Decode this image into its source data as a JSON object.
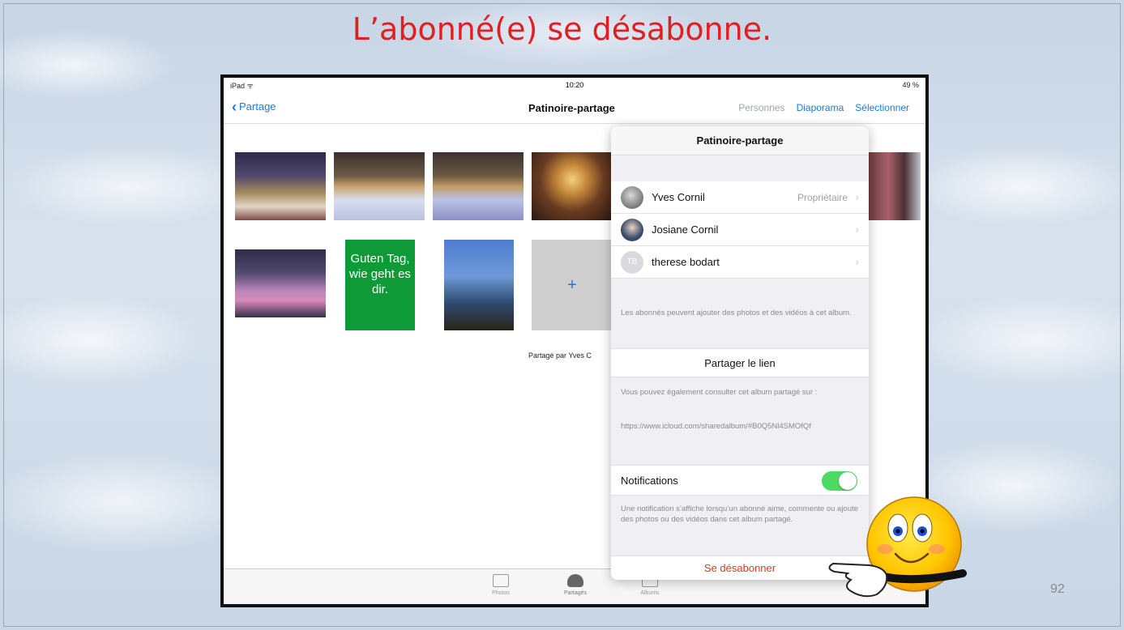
{
  "slide": {
    "title": "L’abonné(e) se désabonne.",
    "page_number": "92"
  },
  "ipad": {
    "status": {
      "left": "iPad ᯤ",
      "time": "10:20",
      "battery": "49 %"
    },
    "nav": {
      "back_label": "Partage",
      "title": "Patinoire-partage",
      "people": "Personnes",
      "slideshow": "Diaporama",
      "select": "Sélectionner"
    },
    "text_card": "Guten Tag, wie geht es dir.",
    "add_tile": "+",
    "shared_by": "Partagé par Yves C",
    "tabs": [
      {
        "label": "Photos",
        "icon": "photos-icon"
      },
      {
        "label": "Partagés",
        "icon": "cloud-icon"
      },
      {
        "label": "Albums",
        "icon": "albums-icon"
      }
    ]
  },
  "popover": {
    "title": "Patinoire-partage",
    "people": [
      {
        "name": "Yves Cornil",
        "role": "Propriétaire",
        "initials": ""
      },
      {
        "name": "Josiane Cornil",
        "role": "",
        "initials": ""
      },
      {
        "name": "therese bodart",
        "role": "",
        "initials": "TB"
      }
    ],
    "subscribers_note": "Les abonnés peuvent ajouter des photos et des vidéos à cet album.",
    "share_link": "Partager le lien",
    "web_note": "Vous pouvez également consulter cet album partagé sur :",
    "web_url": "https://www.icloud.com/sharedalbum/#B0Q5Nl4SMOfQf",
    "notifications_label": "Notifications",
    "notifications_on": true,
    "notifications_note": "Une notification s’affiche lorsqu’un abonné aime, commente ou ajoute des photos ou des vidéos dans cet album partagé.",
    "unsubscribe": "Se désabonner"
  },
  "colors": {
    "title_red": "#e02020",
    "ios_blue": "#1a7ae0",
    "toggle_green": "#4cd964",
    "destructive_red": "#e0362c"
  }
}
